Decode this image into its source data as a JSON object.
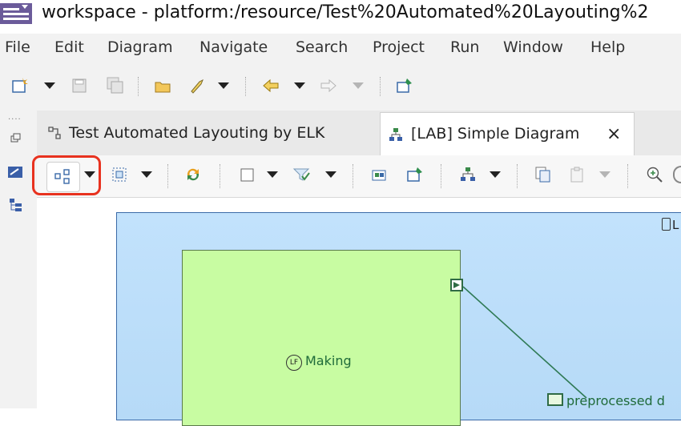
{
  "window": {
    "title": "workspace - platform:/resource/Test%20Automated%20Layouting%2"
  },
  "menu": [
    "File",
    "Edit",
    "Diagram",
    "Navigate",
    "Search",
    "Project",
    "Run",
    "Window",
    "Help"
  ],
  "tabs": [
    {
      "label": "Test Automated Layouting by ELK",
      "active": false
    },
    {
      "label": "[LAB] Simple Diagram",
      "active": true,
      "close": "×"
    }
  ],
  "diagram": {
    "node_making": "Making",
    "node_making_prefix": "LF",
    "preprocessed_label": "preprocessed d",
    "container_badge": "L"
  },
  "colors": {
    "highlight": "#e8321f",
    "container_fill": "#bcdffb",
    "node_fill": "#c8fca2",
    "edge": "#2f7a55"
  },
  "icons": {
    "toolbar": [
      "new-icon",
      "save-icon",
      "save-all-icon",
      "open-icon",
      "tool-icon",
      "back-arrow-icon",
      "forward-arrow-icon",
      "pin-icon"
    ],
    "diagram_toolbar": [
      "arrange-all-icon",
      "select-icon",
      "refresh-icon",
      "layer-icon",
      "filter-icon",
      "export-icon",
      "pin-diagram-icon",
      "hierarchy-icon",
      "copy-format-icon",
      "paste-format-icon",
      "zoom-in-icon"
    ]
  }
}
